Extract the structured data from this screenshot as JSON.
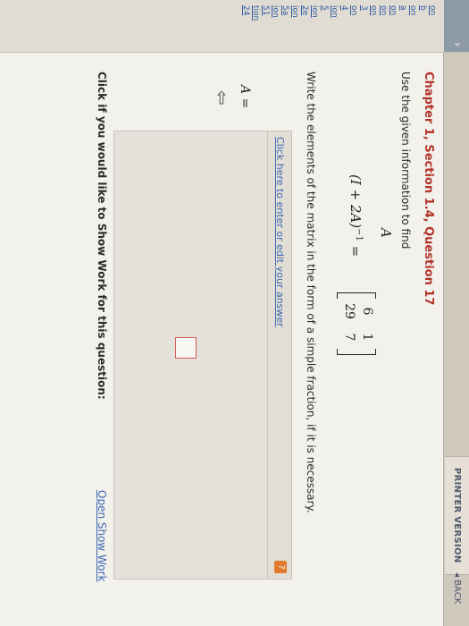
{
  "toolbar": {
    "printer_version": "PRINTER VERSION",
    "back": "◂ BACK"
  },
  "sidebar": {
    "items": [
      "on",
      "b",
      "on",
      "a",
      "on",
      "on",
      "on",
      "3",
      "on",
      "4",
      "ion",
      "5",
      "ion",
      "2e",
      "ion",
      "5a",
      "ion",
      "51",
      "tion",
      "24"
    ]
  },
  "question": {
    "title": "Chapter 1, Section 1.4, Question 17",
    "instruction": "Use the given information to find",
    "target": "A",
    "equation_lhs": "(I + 2A)",
    "equation_exp": "−1",
    "equals": "=",
    "matrix": [
      [
        "6",
        "1"
      ],
      [
        "29",
        "7"
      ]
    ],
    "directions": "Write the elements of the matrix in the form of a simple fraction, if it is necessary."
  },
  "answer": {
    "edit_link": "Click here to enter or edit your answer",
    "help_badge": "?",
    "label": "A ="
  },
  "show_work": {
    "prompt": "Click if you would like to Show Work for this question:",
    "link": "Open Show Work"
  }
}
